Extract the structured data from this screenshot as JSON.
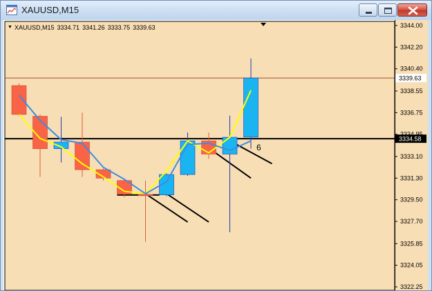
{
  "window": {
    "title": "XAUUSD,M15",
    "icon": "chart-window-icon"
  },
  "info_line": {
    "symbol": "XAUUSD,M15",
    "open": "3334.71",
    "high": "3341.26",
    "low": "3333.75",
    "close": "3339.63"
  },
  "colors": {
    "background": "#f8deb5",
    "bull": "#1ab4f0",
    "bear": "#fa6446",
    "ma_fast": "#ffff00",
    "ma_slow": "#3c8ce6",
    "level_line": "#000000",
    "current_price_line": "#a0522d"
  },
  "chart_data": {
    "type": "candlestick",
    "symbol": "XAUUSD",
    "timeframe": "M15",
    "price_axis_ticks": [
      "3344.00",
      "3342.20",
      "3340.40",
      "3338.55",
      "3336.75",
      "3334.95",
      "3333.10",
      "3331.30",
      "3329.50",
      "3327.70",
      "3325.85",
      "3324.05",
      "3322.25"
    ],
    "ylim": [
      3322.25,
      3344.0
    ],
    "current_price_label": "3339.63",
    "level_label": "3334.58",
    "level_price": 3334.58,
    "candles": [
      {
        "o": 3339.0,
        "h": 3339.2,
        "l": 3336.45,
        "c": 3336.6
      },
      {
        "o": 3336.45,
        "h": 3336.6,
        "l": 3331.4,
        "c": 3333.75
      },
      {
        "o": 3333.75,
        "h": 3336.4,
        "l": 3332.6,
        "c": 3334.3
      },
      {
        "o": 3334.3,
        "h": 3336.75,
        "l": 3331.4,
        "c": 3332.0
      },
      {
        "o": 3332.0,
        "h": 3332.1,
        "l": 3331.1,
        "c": 3331.3
      },
      {
        "o": 3331.1,
        "h": 3331.2,
        "l": 3329.7,
        "c": 3329.95
      },
      {
        "o": 3329.95,
        "h": 3331.1,
        "l": 3326.0,
        "c": 3329.9
      },
      {
        "o": 3329.9,
        "h": 3331.7,
        "l": 3329.8,
        "c": 3331.6
      },
      {
        "o": 3331.6,
        "h": 3335.1,
        "l": 3331.5,
        "c": 3334.4
      },
      {
        "o": 3334.4,
        "h": 3335.1,
        "l": 3332.9,
        "c": 3333.3
      },
      {
        "o": 3333.3,
        "h": 3336.5,
        "l": 3326.8,
        "c": 3334.7
      },
      {
        "o": 3334.71,
        "h": 3341.26,
        "l": 3333.75,
        "c": 3339.63
      }
    ],
    "ma_fast": [
      3336.6,
      3334.6,
      3333.9,
      3332.5,
      3331.4,
      3330.2,
      3330.0,
      3331.9,
      3334.4,
      3333.4,
      3334.7,
      3338.6
    ],
    "ma_slow": [
      3338.2,
      3336.1,
      3334.5,
      3334.2,
      3332.2,
      3331.2,
      3330.0,
      3331.0,
      3334.1,
      3334.2,
      3333.6,
      3334.4
    ],
    "trend_lines": [
      {
        "from_candle": 6,
        "to_candle": 8,
        "from_price": 3330.0,
        "to_price": 3327.65
      },
      {
        "from_candle": 7,
        "to_candle": 9,
        "from_price": 3330.0,
        "to_price": 3327.65
      },
      {
        "from_candle": 9,
        "to_candle": 11,
        "from_price": 3333.8,
        "to_price": 3331.3
      },
      {
        "from_candle": 10,
        "to_candle": 12,
        "from_price": 3334.4,
        "to_price": 3332.5
      }
    ],
    "horizontal_segment": {
      "from_candle": 5,
      "to_candle": 7,
      "price": 3329.9
    },
    "arrow_mark_candle": 11,
    "arrow_mark_symbol": "6"
  }
}
